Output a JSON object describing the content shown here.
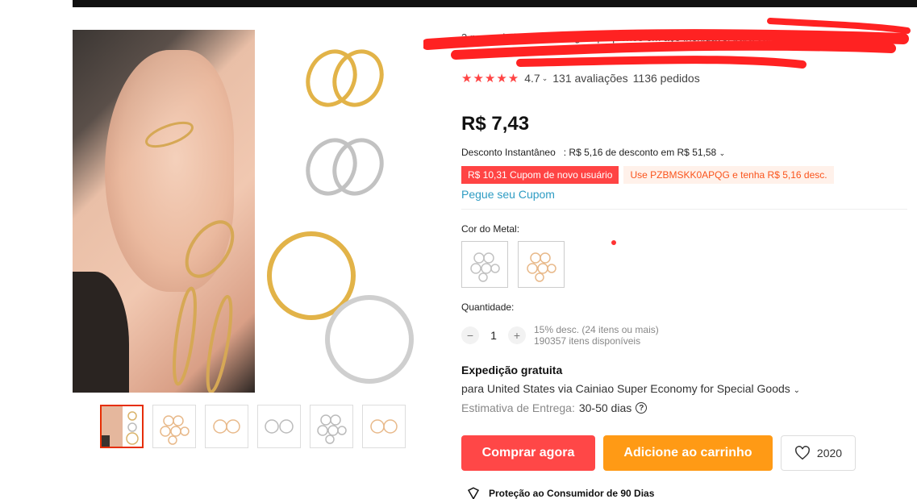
{
  "title": "3 pares de brincos de argola pequenos em aço inoxidável para cartilagem tamanho",
  "rating": {
    "score": "4.7",
    "reviews": "131 avaliações",
    "orders": "1136 pedidos"
  },
  "price": "R$ 7,43",
  "discount": {
    "label": "Desconto Instantâneo",
    "text": ": R$ 5,16 de desconto em R$ 51,58"
  },
  "coupons": {
    "new_user": "R$ 10,31 Cupom de novo usuário",
    "code": "Use PZBMSKK0APQG e tenha R$ 5,16 desc."
  },
  "get_coupon": "Pegue seu Cupom",
  "metal_label": "Cor do Metal:",
  "quantity": {
    "label": "Quantidade:",
    "value": "1",
    "discount_note": "15% desc. (24 itens ou mais)",
    "stock": "190357 itens disponíveis",
    "minus": "−",
    "plus": "+"
  },
  "shipping": {
    "title": "Expedição gratuita",
    "line": "para United States via Cainiao Super Economy for Special Goods",
    "eta_label": "Estimativa de Entrega:",
    "eta_value": "30-50 dias"
  },
  "buttons": {
    "buy": "Comprar agora",
    "cart": "Adicione ao carrinho",
    "wish_count": "2020"
  },
  "protection": "Proteção ao Consumidor de 90 Dias",
  "colors": {
    "accent_red": "#ff4747",
    "accent_orange": "#ff9a15",
    "gold": "#e2b348",
    "silver": "#c2c2c2"
  },
  "icons": {
    "chevron": "chevron-down-icon",
    "heart": "heart-icon",
    "help": "help-icon",
    "shield": "shield-icon"
  }
}
